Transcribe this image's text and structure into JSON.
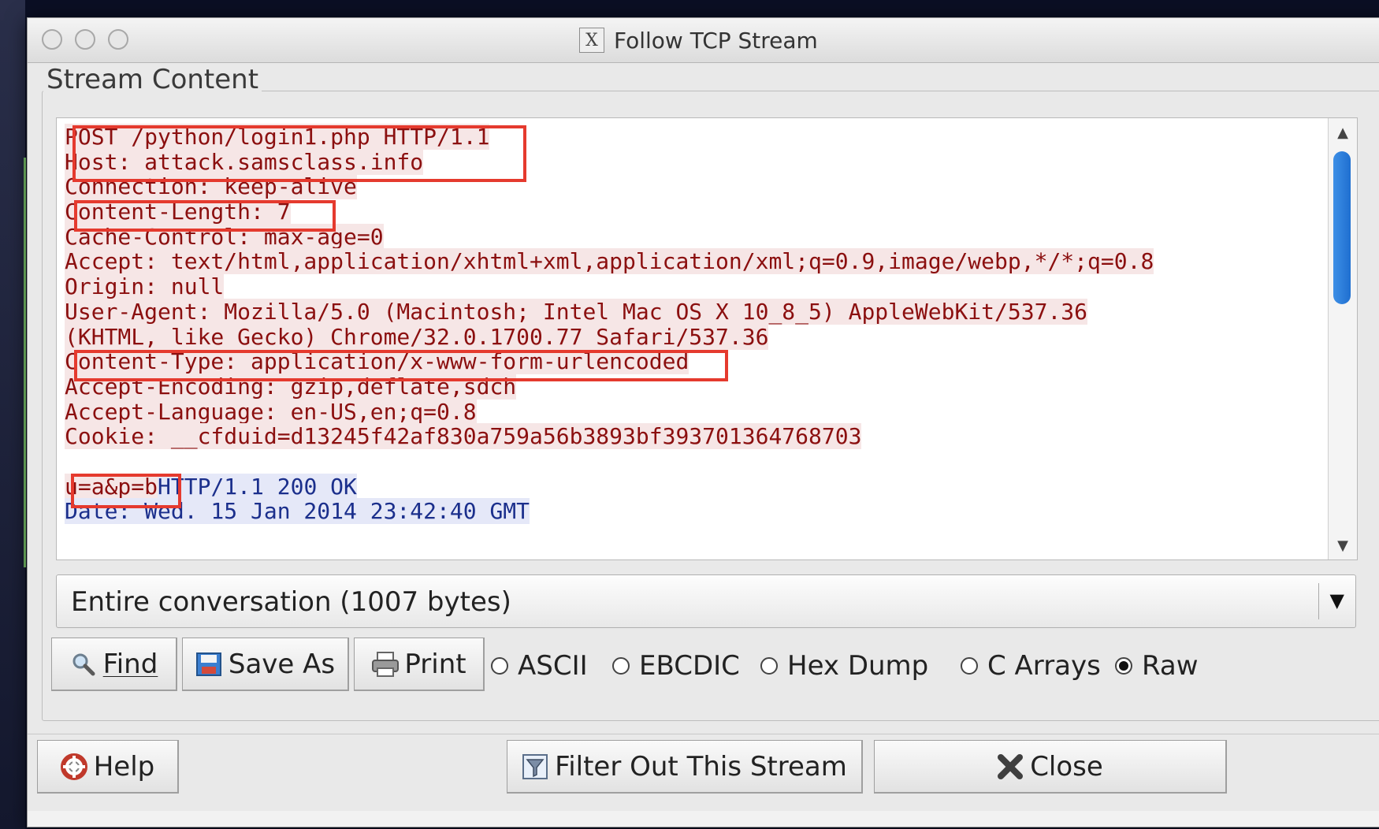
{
  "window": {
    "title": "Follow TCP Stream",
    "title_icon": "X"
  },
  "group": {
    "legend": "Stream Content"
  },
  "stream": {
    "lines": [
      {
        "text": "POST /python/login1.php HTTP/1.1",
        "kind": "req"
      },
      {
        "text": "Host: attack.samsclass.info",
        "kind": "req"
      },
      {
        "text": "Connection: keep-alive",
        "kind": "req"
      },
      {
        "text": "Content-Length: 7",
        "kind": "req"
      },
      {
        "text": "Cache-Control: max-age=0",
        "kind": "req"
      },
      {
        "text": "Accept: text/html,application/xhtml+xml,application/xml;q=0.9,image/webp,*/*;q=0.8",
        "kind": "req"
      },
      {
        "text": "Origin: null",
        "kind": "req"
      },
      {
        "text": "User-Agent: Mozilla/5.0 (Macintosh; Intel Mac OS X 10_8_5) AppleWebKit/537.36",
        "kind": "req"
      },
      {
        "text": "(KHTML, like Gecko) Chrome/32.0.1700.77 Safari/537.36",
        "kind": "req"
      },
      {
        "text": "Content-Type: application/x-www-form-urlencoded",
        "kind": "req"
      },
      {
        "text": "Accept-Encoding: gzip,deflate,sdch",
        "kind": "req"
      },
      {
        "text": "Accept-Language: en-US,en;q=0.8",
        "kind": "req"
      },
      {
        "text": "Cookie: __cfduid=d13245f42af830a759a56b3893bf393701364768703",
        "kind": "req"
      },
      {
        "text": "",
        "kind": "blank"
      },
      {
        "text": "u=a&p=b",
        "kind": "req",
        "continuation": "HTTP/1.1 200 OK"
      },
      {
        "text": "Date: Wed. 15 Jan 2014 23:42:40 GMT",
        "kind": "resp"
      }
    ]
  },
  "conversation": {
    "selected": "Entire conversation (1007 bytes)"
  },
  "toolbar": {
    "find_label": "Find",
    "save_as_label": "Save As",
    "print_label": "Print"
  },
  "format": {
    "options": [
      "ASCII",
      "EBCDIC",
      "Hex Dump",
      "C Arrays",
      "Raw"
    ],
    "selected": "Raw"
  },
  "footer": {
    "help_label": "Help",
    "filter_label": "Filter Out This Stream",
    "close_label": "Close"
  },
  "colors": {
    "request_text": "#8b0f0f",
    "response_text": "#1b2f8c",
    "highlight_box": "#e53a2e",
    "scroll_thumb": "#2a7ddc"
  }
}
